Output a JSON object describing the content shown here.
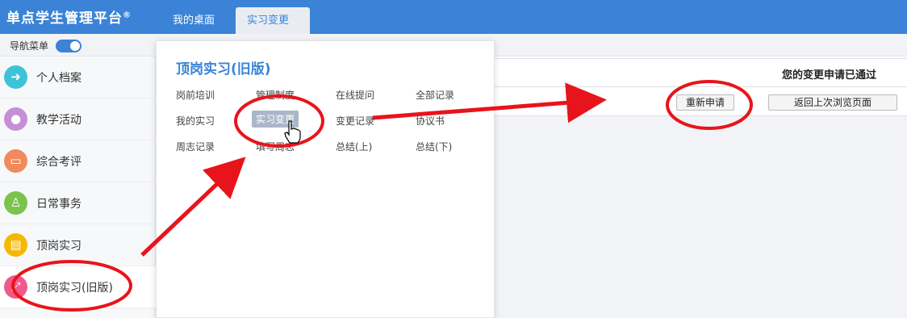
{
  "app": {
    "brand": "单点学生管理平台",
    "brand_mark": "®"
  },
  "tabs": [
    {
      "label": "我的桌面"
    },
    {
      "label": "实习变更",
      "close": "×"
    }
  ],
  "nav_toggle_label": "导航菜单",
  "sidebar": {
    "items": [
      {
        "label": "个人档案",
        "icon": "refresh-icon",
        "color": "#3cc3d8"
      },
      {
        "label": "教学活动",
        "icon": "user-icon",
        "color": "#c48fd6"
      },
      {
        "label": "综合考评",
        "icon": "briefcase-icon",
        "color": "#f08a5d"
      },
      {
        "label": "日常事务",
        "icon": "stamp-icon",
        "color": "#7bc34b"
      },
      {
        "label": "顶岗实习",
        "icon": "document-icon",
        "color": "#f5b800"
      },
      {
        "label": "顶岗实习(旧版)",
        "icon": "share-icon",
        "color": "#ef5a8a"
      }
    ]
  },
  "popup": {
    "title": "顶岗实习(旧版)",
    "links": [
      [
        "岗前培训",
        "管理制度",
        "在线提问",
        "全部记录"
      ],
      [
        "我的实习",
        "实习变更",
        "变更记录",
        "协议书"
      ],
      [
        "周志记录",
        "填写周志",
        "总结(上)",
        "总结(下)"
      ]
    ]
  },
  "content": {
    "status_message": "您的变更申请已通过",
    "reapply_button": "重新申请",
    "back_button": "返回上次浏览页面"
  },
  "colors": {
    "accent": "#3a83d6",
    "annotation": "#e8141b"
  }
}
